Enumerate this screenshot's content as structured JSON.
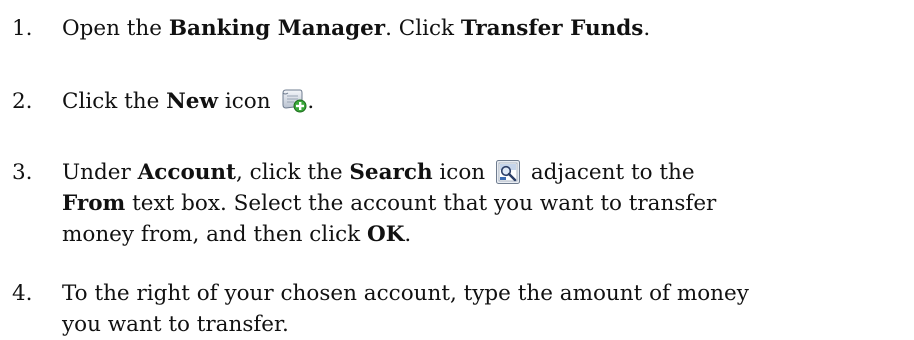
{
  "steps": [
    {
      "number": "1.",
      "text_1": "Open the ",
      "bold_1": "Banking Manager",
      "text_2": ". Click ",
      "bold_2": "Transfer Funds",
      "text_3": "."
    },
    {
      "number": "2.",
      "text_1": "Click the ",
      "bold_1": "New",
      "text_2": " icon ",
      "icon": "new-document-plus-icon",
      "text_3": "."
    },
    {
      "number": "3.",
      "text_1": "Under ",
      "bold_1": "Account",
      "text_2": ", click the ",
      "bold_2": "Search",
      "text_3": " icon ",
      "icon": "search-lookup-icon",
      "text_4": " adjacent to the",
      "bold_3": "From",
      "text_5": " text box. Select the account that you want to transfer",
      "text_6": "money from, and then click ",
      "bold_4": "OK",
      "text_7": "."
    },
    {
      "number": "4.",
      "text_1": "To the right of your chosen account, type the amount of money",
      "text_2": "you want to transfer."
    }
  ]
}
